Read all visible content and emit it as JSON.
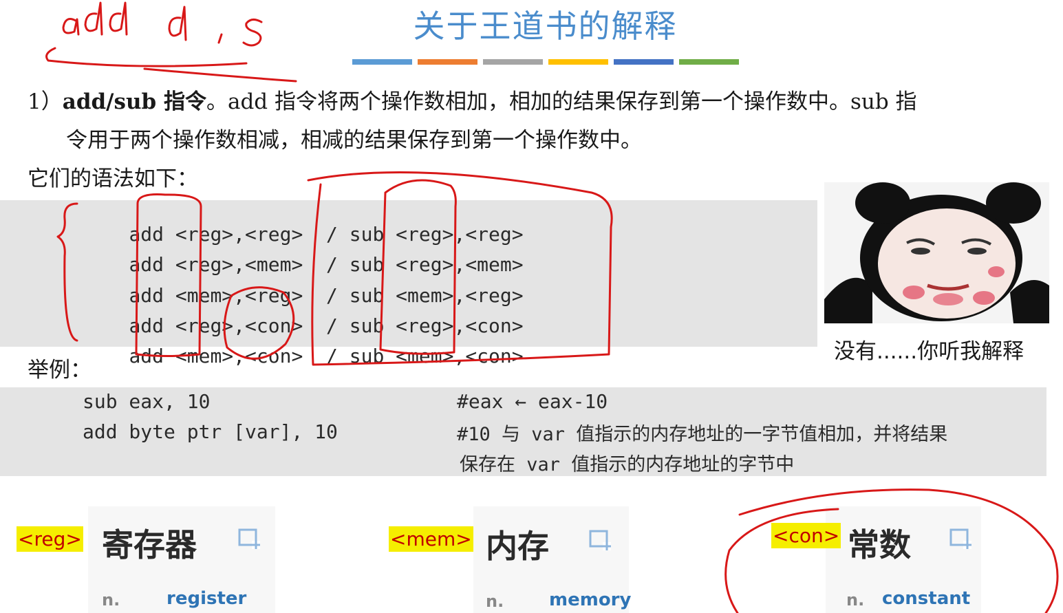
{
  "handwriting": {
    "top_note": "add d , s"
  },
  "title": "关于王道书的解释",
  "color_bars": [
    "#5b9bd5",
    "#ed7d31",
    "#a5a5a5",
    "#ffc000",
    "#4472c4",
    "#70ad47"
  ],
  "paragraph": {
    "prefix": "1）",
    "bold": "add/sub 指令",
    "line1_rest": "。add 指令将两个操作数相加，相加的结果保存到第一个操作数中。sub 指",
    "line2": "令用于两个操作数相减，相减的结果保存到第一个操作数中。"
  },
  "syntax_heading": "它们的语法如下：",
  "syntax_rows": [
    {
      "left": "add <reg>,<reg>",
      "sep": "/",
      "right": "sub <reg>,<reg>"
    },
    {
      "left": "add <reg>,<mem>",
      "sep": "/",
      "right": "sub <reg>,<mem>"
    },
    {
      "left": "add <mem>,<reg>",
      "sep": "/",
      "right": "sub <mem>,<reg>"
    },
    {
      "left": "add <reg>,<con>",
      "sep": "/",
      "right": "sub <reg>,<con>"
    },
    {
      "left": "add <mem>,<con>",
      "sep": "/",
      "right": "sub <mem>,<con>"
    }
  ],
  "example_heading": "举例：",
  "examples": [
    {
      "code": "sub eax, 10",
      "comment": "#eax ← eax-10",
      "comment2": ""
    },
    {
      "code": "add byte ptr [var], 10",
      "comment": "#10 与 var 值指示的内存地址的一字节值相加，并将结果",
      "comment2": "保存在 var 值指示的内存地址的字节中"
    }
  ],
  "meme_caption": "没有......你听我解释",
  "vocab": [
    {
      "tag": "<reg>",
      "chinese": "寄存器",
      "pos": "n.",
      "english": "register"
    },
    {
      "tag": "<mem>",
      "chinese": "内存",
      "pos": "n.",
      "english": "memory"
    },
    {
      "tag": "<con>",
      "chinese": "常数",
      "pos": "n.",
      "english": "constant"
    }
  ]
}
